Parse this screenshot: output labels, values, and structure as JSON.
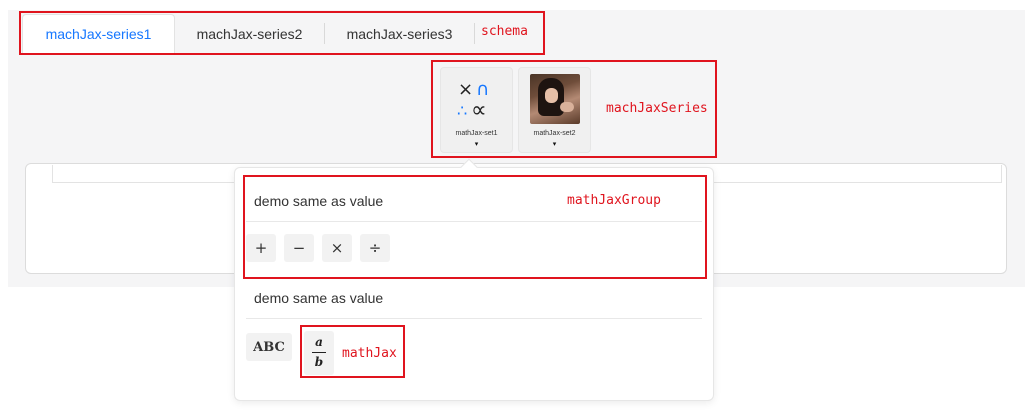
{
  "tabs": [
    {
      "label": "machJax-series1",
      "active": true
    },
    {
      "label": "machJax-series2",
      "active": false
    },
    {
      "label": "machJax-series3",
      "active": false
    }
  ],
  "annotations": {
    "schema": "schema",
    "series": "machJaxSeries",
    "group": "mathJaxGroup",
    "mathjax": "mathJax"
  },
  "series_cards": [
    {
      "label": "mathJax-set1",
      "icon": "math-symbols-icon",
      "caret": "▾"
    },
    {
      "label": "mathJax-set2",
      "icon": "photo-thumbnail",
      "caret": "▾"
    }
  ],
  "card1_symbols": {
    "times": "×",
    "cap": "∩",
    "dots": "∴",
    "propto": "∝"
  },
  "groups": [
    {
      "title": "demo same as value",
      "buttons": [
        "+",
        "−",
        "×",
        "÷"
      ]
    },
    {
      "title": "demo same as value",
      "buttons": [
        "ABC"
      ]
    }
  ],
  "fraction": {
    "numerator": "a",
    "denominator": "b"
  },
  "colors": {
    "accent": "#1677ff",
    "annotation": "#e0141e",
    "panel": "#f5f5f6"
  }
}
